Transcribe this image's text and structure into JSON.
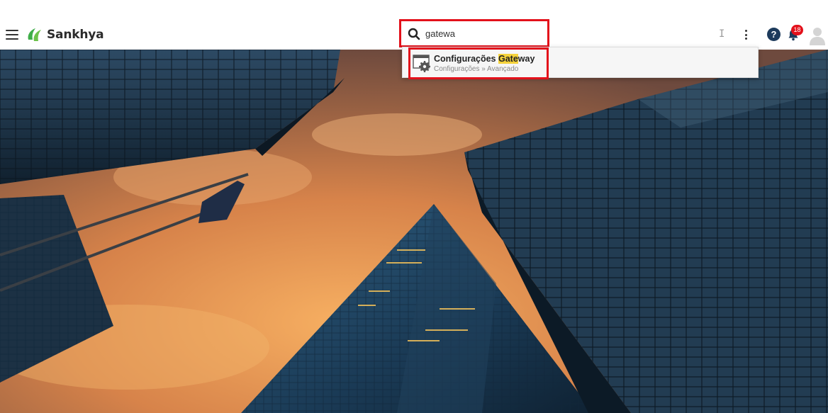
{
  "app": {
    "name": "Sankhya"
  },
  "search": {
    "value": "gatewa",
    "results": [
      {
        "title_prefix": "Configurações ",
        "title_highlight": "Gate",
        "title_suffix": "way",
        "path": "Configurações » Avançado"
      }
    ]
  },
  "header": {
    "help_label": "?",
    "notification_count": "18"
  },
  "colors": {
    "highlight_border": "#e3111b",
    "brand_green": "#3fae49",
    "help_navy": "#1d3b5c",
    "match_highlight": "#f5d33b"
  },
  "icons": [
    "menu-icon",
    "logo-mark-icon",
    "search-icon",
    "text-cursor-icon",
    "kebab-menu-icon",
    "help-icon",
    "bell-icon",
    "user-avatar-icon",
    "settings-window-icon"
  ]
}
